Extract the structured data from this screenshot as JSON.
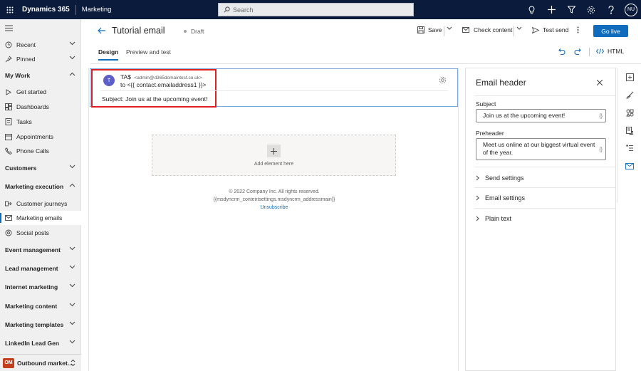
{
  "topbar": {
    "brand": "Dynamics 365",
    "app": "Marketing",
    "search_placeholder": "Search",
    "user_initials": "NU"
  },
  "sidebar": {
    "items": [
      {
        "label": "Recent",
        "icon": "clock-icon",
        "kind": "item",
        "chevron": true
      },
      {
        "label": "Pinned",
        "icon": "pin-icon",
        "kind": "item",
        "chevron": true
      },
      {
        "label": "My Work",
        "kind": "group",
        "chevron": "up"
      },
      {
        "label": "Get started",
        "icon": "play-icon",
        "kind": "item"
      },
      {
        "label": "Dashboards",
        "icon": "dashboard-icon",
        "kind": "item"
      },
      {
        "label": "Tasks",
        "icon": "tasks-icon",
        "kind": "item"
      },
      {
        "label": "Appointments",
        "icon": "calendar-icon",
        "kind": "item"
      },
      {
        "label": "Phone Calls",
        "icon": "phone-icon",
        "kind": "item"
      },
      {
        "label": "Customers",
        "kind": "group",
        "chevron": "down"
      },
      {
        "label": "Marketing execution",
        "kind": "group",
        "chevron": "up"
      },
      {
        "label": "Customer journeys",
        "icon": "journey-icon",
        "kind": "item"
      },
      {
        "label": "Marketing emails",
        "icon": "mail-icon",
        "kind": "item",
        "active": true
      },
      {
        "label": "Social posts",
        "icon": "social-icon",
        "kind": "item"
      },
      {
        "label": "Event management",
        "kind": "group",
        "chevron": "down"
      },
      {
        "label": "Lead management",
        "kind": "group",
        "chevron": "down"
      },
      {
        "label": "Internet marketing",
        "kind": "group",
        "chevron": "down"
      },
      {
        "label": "Marketing content",
        "kind": "group",
        "chevron": "down"
      },
      {
        "label": "Marketing templates",
        "kind": "group",
        "chevron": "down"
      },
      {
        "label": "LinkedIn Lead Gen",
        "kind": "group",
        "chevron": "down"
      }
    ],
    "area": {
      "badge": "OM",
      "label": "Outbound market..."
    }
  },
  "command": {
    "title": "Tutorial email",
    "status": "Draft",
    "save": "Save",
    "check_content": "Check content",
    "test_send": "Test send",
    "go_live": "Go live"
  },
  "tabs": {
    "design": "Design",
    "preview": "Preview and test",
    "html": "HTML"
  },
  "email": {
    "avatar": "T",
    "from_name": "TA$",
    "from_email": "<admin@d365domaintest.co.uk>",
    "to": "to <{{ contact.emailaddress1 }}>",
    "subject_label": "Subject:",
    "subject": "Join us at the upcoming event!",
    "add_element": "Add element here",
    "footer_copyright": "© 2022 Company Inc. All rights reserved.",
    "footer_address": "{{msdyncrm_contentsettings.msdyncrm_addressmain}}",
    "unsubscribe": "Unsubscribe"
  },
  "panel": {
    "title": "Email header",
    "subject_label": "Subject",
    "subject_value": "Join us at the upcoming event!",
    "preheader_label": "Preheader",
    "preheader_value": "Meet us online at our biggest virtual event of the year.",
    "brace": "{}",
    "sections": [
      "Send settings",
      "Email settings",
      "Plain text"
    ]
  },
  "colors": {
    "topbar": "#0b1b3b",
    "accent": "#0f6cbd",
    "highlight": "#e02020",
    "avatar": "#5b5fc7",
    "area_badge": "#c43e1c"
  }
}
